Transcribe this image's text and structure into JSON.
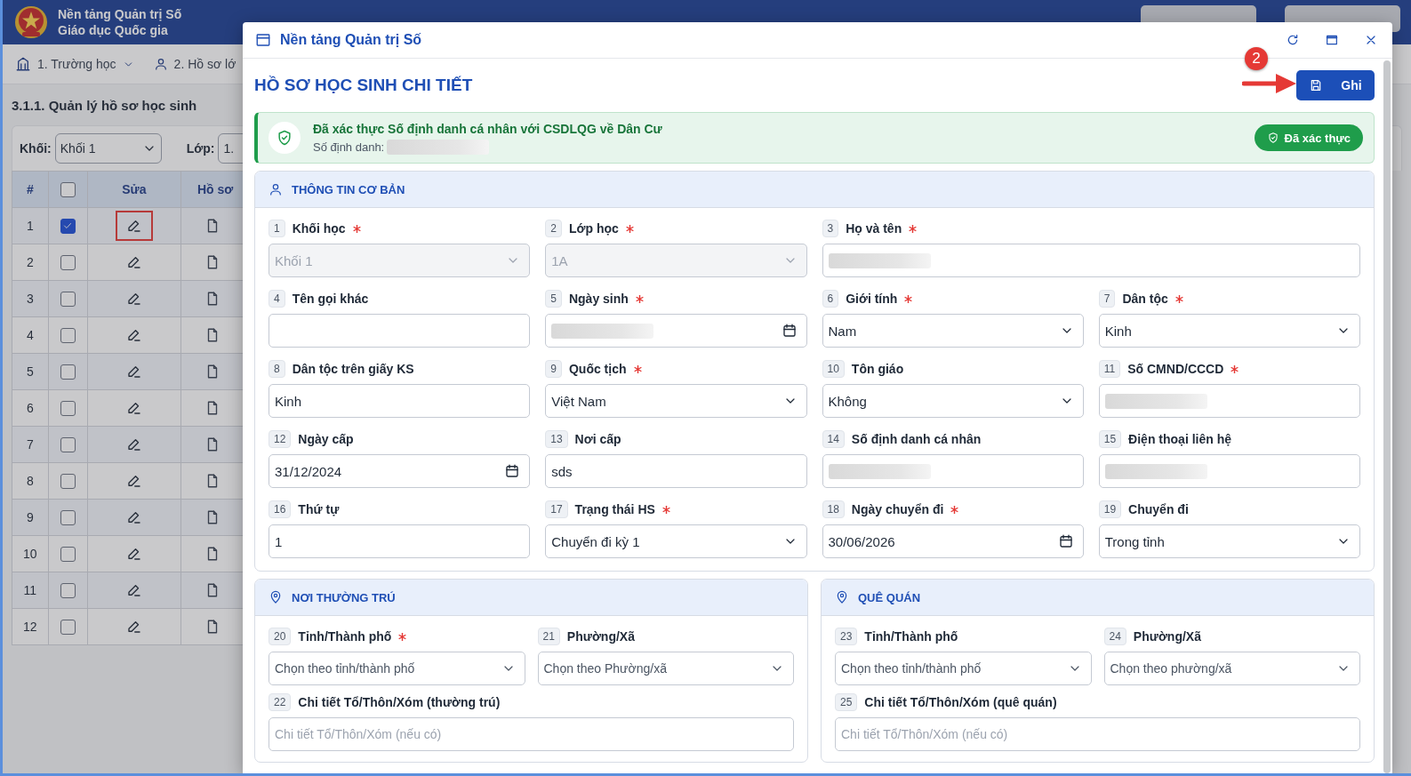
{
  "app": {
    "title_lines": [
      "Nền tảng Quản trị Số",
      "Giáo dục Quốc gia"
    ],
    "nav": [
      {
        "label": "1. Trường học",
        "dropdown": true
      },
      {
        "label": "2. Hồ sơ lớ",
        "dropdown": false
      }
    ],
    "page_title": "3.1.1. Quản lý hồ sơ học sinh",
    "filters": [
      {
        "label": "Khối:",
        "value": "Khối 1"
      },
      {
        "label": "Lớp:",
        "value": "1."
      }
    ],
    "table": {
      "columns": [
        "#",
        "Sửa",
        "Hồ sơ"
      ],
      "select_all_checked": false,
      "rows": [
        {
          "number": "1",
          "checked": true,
          "edit_highlighted": true
        },
        {
          "number": "2",
          "checked": false,
          "edit_highlighted": false
        },
        {
          "number": "3",
          "checked": false,
          "edit_highlighted": false
        },
        {
          "number": "4",
          "checked": false,
          "edit_highlighted": false
        },
        {
          "number": "5",
          "checked": false,
          "edit_highlighted": false
        },
        {
          "number": "6",
          "checked": false,
          "edit_highlighted": false
        },
        {
          "number": "7",
          "checked": false,
          "edit_highlighted": false
        },
        {
          "number": "8",
          "checked": false,
          "edit_highlighted": false
        },
        {
          "number": "9",
          "checked": false,
          "edit_highlighted": false
        },
        {
          "number": "10",
          "checked": false,
          "edit_highlighted": false
        },
        {
          "number": "11",
          "checked": false,
          "edit_highlighted": false
        },
        {
          "number": "12",
          "checked": false,
          "edit_highlighted": false
        }
      ]
    }
  },
  "modal": {
    "title": "Nền tảng Quản trị Số",
    "heading": "HỒ SƠ HỌC SINH CHI TIẾT",
    "save_button": "Ghi",
    "callout": "2",
    "verification": {
      "title": "Đã xác thực Số định danh cá nhân với CSDLQG về Dân Cư",
      "id_label": "Số định danh:",
      "id_redacted": true,
      "badge": "Đã xác thực"
    },
    "basic_info": {
      "title": "THÔNG TIN CƠ BẢN",
      "rows": [
        [
          {
            "number": "1",
            "label": "Khối học",
            "required": true,
            "kind": "select",
            "value": "Khối 1",
            "disabled": true,
            "redacted": false
          },
          {
            "number": "2",
            "label": "Lớp học",
            "required": true,
            "kind": "select",
            "value": "1A",
            "disabled": true,
            "redacted": false
          },
          {
            "number": "3",
            "label": "Họ và tên",
            "required": true,
            "kind": "text",
            "disabled": false,
            "redacted": true
          }
        ],
        [
          {
            "number": "4",
            "label": "Tên gọi khác",
            "required": false,
            "kind": "text",
            "disabled": false,
            "redacted": false
          },
          {
            "number": "5",
            "label": "Ngày sinh",
            "required": true,
            "kind": "date",
            "disabled": false,
            "redacted": true
          },
          {
            "number": "6",
            "label": "Giới tính",
            "required": true,
            "kind": "select",
            "value": "Nam",
            "disabled": false,
            "redacted": false
          },
          {
            "number": "7",
            "label": "Dân tộc",
            "required": true,
            "kind": "select",
            "value": "Kinh",
            "disabled": false,
            "redacted": false
          }
        ],
        [
          {
            "number": "8",
            "label": "Dân tộc trên giấy KS",
            "required": false,
            "kind": "text",
            "value": "Kinh",
            "disabled": false,
            "redacted": false
          },
          {
            "number": "9",
            "label": "Quốc tịch",
            "required": true,
            "kind": "select",
            "value": "Việt Nam",
            "disabled": false,
            "redacted": false
          },
          {
            "number": "10",
            "label": "Tôn giáo",
            "required": false,
            "kind": "select",
            "value": "Không",
            "disabled": false,
            "redacted": false
          },
          {
            "number": "11",
            "label": "Số CMND/CCCD",
            "required": true,
            "kind": "text",
            "disabled": false,
            "redacted": true
          }
        ],
        [
          {
            "number": "12",
            "label": "Ngày cấp",
            "required": false,
            "kind": "date",
            "value": "31/12/2024",
            "disabled": false,
            "redacted": false
          },
          {
            "number": "13",
            "label": "Nơi cấp",
            "required": false,
            "kind": "text",
            "value": "sds",
            "disabled": false,
            "redacted": false
          },
          {
            "number": "14",
            "label": "Số định danh cá nhân",
            "required": false,
            "kind": "text",
            "disabled": false,
            "redacted": true
          },
          {
            "number": "15",
            "label": "Điện thoại liên hệ",
            "required": false,
            "kind": "text",
            "disabled": false,
            "redacted": true
          }
        ],
        [
          {
            "number": "16",
            "label": "Thứ tự",
            "required": false,
            "kind": "text",
            "value": "1",
            "disabled": false,
            "redacted": false
          },
          {
            "number": "17",
            "label": "Trạng thái HS",
            "required": true,
            "kind": "select",
            "value": "Chuyển đi kỳ 1",
            "disabled": false,
            "redacted": false
          },
          {
            "number": "18",
            "label": "Ngày chuyển đi",
            "required": true,
            "kind": "date",
            "value": "30/06/2026",
            "disabled": false,
            "redacted": false
          },
          {
            "number": "19",
            "label": "Chuyển đi",
            "required": false,
            "kind": "select",
            "value": "Trong tỉnh",
            "disabled": false,
            "redacted": false
          }
        ]
      ]
    },
    "addresses": [
      {
        "title": "NƠI THƯỜNG TRÚ",
        "rows": [
          [
            {
              "number": "20",
              "label": "Tỉnh/Thành phố",
              "required": true,
              "kind": "select",
              "placeholder": "Chọn theo tỉnh/thành phố",
              "disabled": false,
              "redacted": false
            },
            {
              "number": "21",
              "label": "Phường/Xã",
              "required": false,
              "kind": "select",
              "placeholder": "Chọn theo Phường/xã",
              "disabled": false,
              "redacted": false
            }
          ],
          [
            {
              "number": "22",
              "label": "Chi tiết Tổ/Thôn/Xóm (thường trú)",
              "required": false,
              "kind": "text",
              "placeholder": "Chi tiết Tổ/Thôn/Xóm (nếu có)",
              "disabled": false,
              "redacted": false
            }
          ]
        ]
      },
      {
        "title": "QUÊ QUÁN",
        "rows": [
          [
            {
              "number": "23",
              "label": "Tỉnh/Thành phố",
              "required": false,
              "kind": "select",
              "placeholder": "Chọn theo tỉnh/thành phố",
              "disabled": false,
              "redacted": false
            },
            {
              "number": "24",
              "label": "Phường/Xã",
              "required": false,
              "kind": "select",
              "placeholder": "Chọn theo phường/xã",
              "disabled": false,
              "redacted": false
            }
          ],
          [
            {
              "number": "25",
              "label": "Chi tiết Tổ/Thôn/Xóm (quê quán)",
              "required": false,
              "kind": "text",
              "placeholder": "Chi tiết Tổ/Thôn/Xóm (nếu có)",
              "disabled": false,
              "redacted": false
            }
          ]
        ]
      }
    ]
  }
}
